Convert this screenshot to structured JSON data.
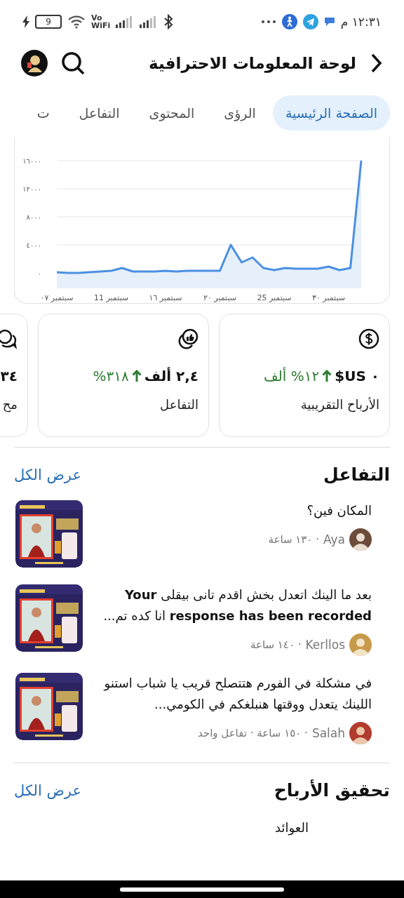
{
  "status_bar": {
    "time": "١٢:٣١ م",
    "battery": "9",
    "network_top": "Vo",
    "network_bottom": "WiFi"
  },
  "header": {
    "title": "لوحة المعلومات الاحترافية"
  },
  "tabs": [
    {
      "label": "الصفحة الرئيسية",
      "selected": true
    },
    {
      "label": "الرؤى",
      "selected": false
    },
    {
      "label": "المحتوى",
      "selected": false
    },
    {
      "label": "التفاعل",
      "selected": false
    },
    {
      "label": "ت",
      "selected": false
    }
  ],
  "chart": {
    "chart_data": {
      "type": "area",
      "grid": true,
      "categories": [
        "سبتمبر ٠٧",
        null,
        null,
        null,
        null,
        "سبتمبر 11",
        null,
        null,
        null,
        null,
        "سبتمبر ١٦",
        null,
        null,
        null,
        null,
        "سبتمبر ٢٠",
        null,
        null,
        null,
        null,
        "سبتمبر 25",
        null,
        null,
        null,
        null,
        "سبتمبر ٣٠",
        null,
        null,
        null
      ],
      "values": [
        100,
        0,
        0,
        100,
        200,
        300,
        700,
        200,
        200,
        200,
        300,
        200,
        300,
        300,
        300,
        300,
        4000,
        1500,
        2200,
        700,
        400,
        700,
        600,
        600,
        600,
        900,
        400,
        700,
        16000
      ],
      "ylim": [
        0,
        16000
      ],
      "yticks": [
        {
          "value": 0,
          "label": "٠"
        },
        {
          "value": 4000,
          "label": "٤٠٠٠"
        },
        {
          "value": 8000,
          "label": "٨٠٠٠"
        },
        {
          "value": 12000,
          "label": "١٢٠٠٠"
        },
        {
          "value": 16000,
          "label": "١٦٠٠٠"
        }
      ]
    }
  },
  "stats": [
    {
      "kind": "money",
      "value": "٠ US$",
      "up": true,
      "change": "١٢% ألف",
      "label": "الأرباح التقريبية"
    },
    {
      "kind": "engagement",
      "value": "٢,٤ ألف",
      "up": true,
      "change": "٣١٨%",
      "label": "التفاعل"
    },
    {
      "kind": "comments",
      "value": "٣٤",
      "label": "مح"
    }
  ],
  "engagement": {
    "title": "التفاعل",
    "link": "عرض الكل",
    "items": [
      {
        "text": "المكان فين؟",
        "name": "Aya",
        "meta": "· ١٣٠ ساعة"
      },
      {
        "text": "بعد ما الينك اتعدل بخش اقدم تانى بيقلى **Your response has been recorded** انا كده تم...",
        "name": "Kerllos",
        "meta": "· ١٤٠ ساعة"
      },
      {
        "text": "في مشكلة في الفورم هتتصلح قريب يا شباب استنو اللينك يتعدل ووقتها هنبلغكم في الكومي...",
        "name": "Salah",
        "meta": "· ١٥٠ ساعة · تفاعل واحد"
      }
    ]
  },
  "monetization": {
    "title": "تحقيق الأرباح",
    "link": "عرض الكل",
    "row_label": "العوائد"
  }
}
